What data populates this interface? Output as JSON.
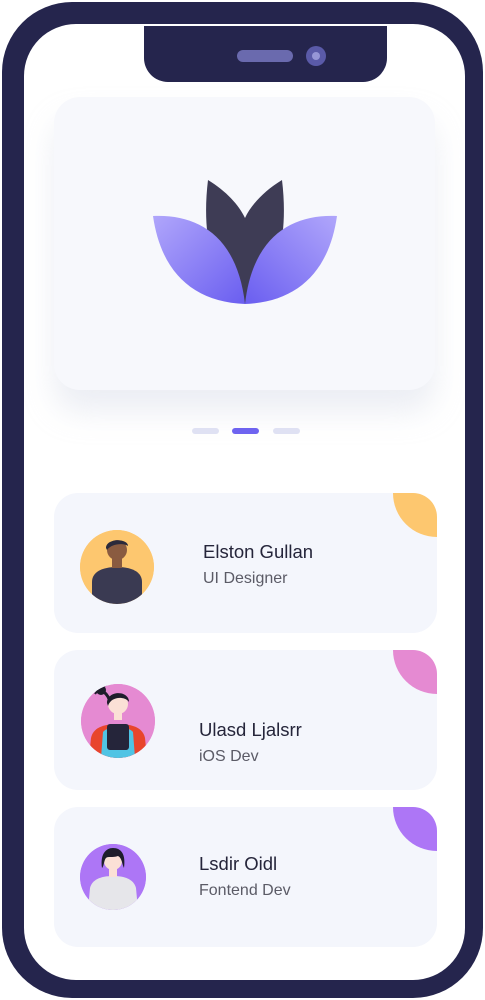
{
  "carousel": {
    "indicators": [
      {
        "active": false
      },
      {
        "active": true
      },
      {
        "active": false
      }
    ]
  },
  "contacts": [
    {
      "name": "Elston Gullan",
      "role": "UI Designer",
      "accent": "#fdc76f",
      "avatar_bg": "#fdc76f",
      "icon": "man-avatar-icon"
    },
    {
      "name": "Ulasd Ljalsrr",
      "role": "iOS Dev",
      "accent": "#e58ad2",
      "avatar_bg": "#e58ad2",
      "icon": "woman-with-tablet-avatar-icon"
    },
    {
      "name": "Lsdir Oidl",
      "role": "Fontend Dev",
      "accent": "#ad76f6",
      "avatar_bg": "#ad76f6",
      "icon": "woman-avatar-icon"
    }
  ],
  "colors": {
    "frame": "#25254d",
    "logo_dark": "#3e3c55",
    "logo_light": "#a79cfb",
    "logo_deep": "#6b5ef2",
    "indicator_active": "#6e63f0",
    "indicator_inactive": "#dfe1f3"
  }
}
